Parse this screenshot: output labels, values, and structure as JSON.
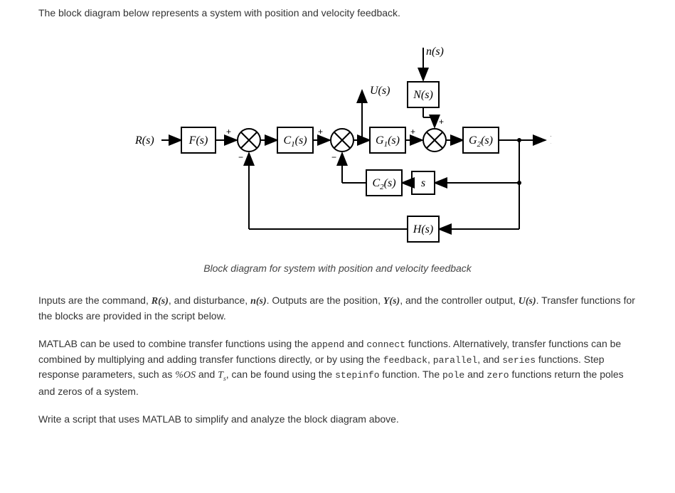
{
  "intro": "The block diagram below represents a system with position and velocity feedback.",
  "caption": "Block diagram for system with position and velocity feedback",
  "diagram": {
    "Rs": "R(s)",
    "Fs": "F(s)",
    "C1s": "C",
    "C1sub": "1",
    "C1tail": "(s)",
    "G1s": "G",
    "G1sub": "1",
    "G1tail": "(s)",
    "G2s": "G",
    "G2sub": "2",
    "G2tail": "(s)",
    "Ns": "N(s)",
    "ns": "n(s)",
    "Us": "U(s)",
    "Ys": "Y(s)",
    "C2s": "C",
    "C2sub": "2",
    "C2tail": "(s)",
    "s": "s",
    "Hs": "H(s)",
    "plus": "+",
    "minus": "−"
  },
  "text": {
    "p2a": "Inputs are the command, ",
    "Rs": "R(s)",
    "p2b": ", and disturbance, ",
    "ns": "n(s)",
    "p2c": ". Outputs are the position, ",
    "Ys": "Y(s)",
    "p2d": ", and the controller output, ",
    "Us": "U(s)",
    "p2e": ". Transfer functions for the blocks are provided in the script below.",
    "p3a": "MATLAB can be used to combine transfer functions using the ",
    "append": "append",
    "p3b": " and ",
    "connect": "connect",
    "p3c": " functions. Alternatively, transfer functions can be combined by multiplying and adding transfer functions directly, or by using the ",
    "feedback": "feedback",
    "p3d": ", ",
    "parallel": "parallel",
    "p3e": ", and ",
    "series": "series",
    "p3f": " functions. Step response parameters, such as ",
    "pctOS": "%OS",
    "p3g": " and ",
    "Ts": "T",
    "Tsub": "s",
    "p3h": ", can be found using the ",
    "stepinfo": "stepinfo",
    "p3i": " function. The ",
    "pole": "pole",
    "p3j": " and ",
    "zero": "zero",
    "p3k": " functions return the poles and zeros of a system.",
    "p4": "Write a script that uses MATLAB to simplify and analyze the block diagram above."
  }
}
